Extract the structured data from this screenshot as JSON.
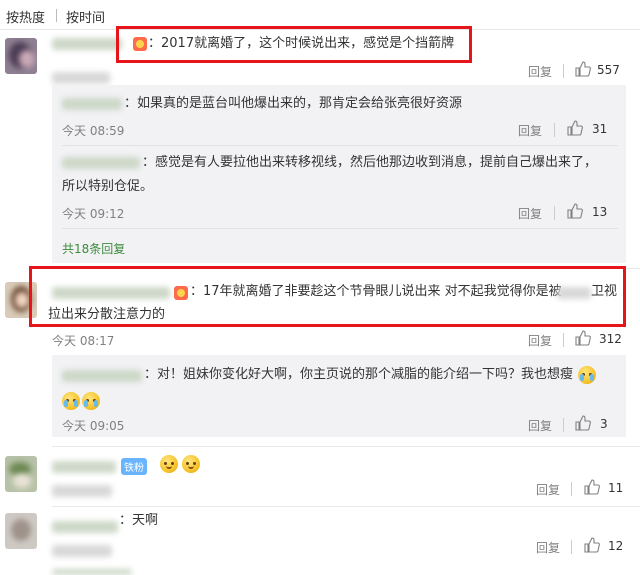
{
  "sort": {
    "hot": "按热度",
    "time": "按时间"
  },
  "reply_label": "回复",
  "comments": [
    {
      "text": "：2017就离婚了，这个时候说出来，感觉是个挡箭牌",
      "likes": "557"
    },
    {
      "text": "：17年就离婚了非要趁这个节骨眼儿说出来 对不起我觉得你是被",
      "text_tail": "卫视",
      "text_line2": "拉出来分散注意力的",
      "time": "今天 08:17",
      "likes": "312"
    },
    {
      "badge": "铁粉",
      "time": "",
      "likes": "11"
    },
    {
      "text": "：天啊",
      "likes": "12"
    }
  ],
  "replies": [
    {
      "text": "：如果真的是蓝台叫他爆出来的，那肯定会给张亮很好资源",
      "time": "今天 08:59",
      "likes": "31"
    },
    {
      "text": "：感觉是有人要拉他出来转移视线，然后他那边收到消息，提前自己爆出来了，",
      "text_line2": "所以特别仓促。",
      "time": "今天 09:12",
      "likes": "13"
    },
    {
      "text": "：对！姐妹你变化好大啊，你主页说的那个减脂的能介绍一下吗？我也想瘦",
      "time": "今天 09:05",
      "likes": "3"
    }
  ],
  "more_replies": "共18条回复",
  "colors": {
    "highlight_border": "#e8141b",
    "reply_bg": "#f2f2f5",
    "link_green": "#3d8b3d",
    "badge_blue": "#69b4ff"
  }
}
